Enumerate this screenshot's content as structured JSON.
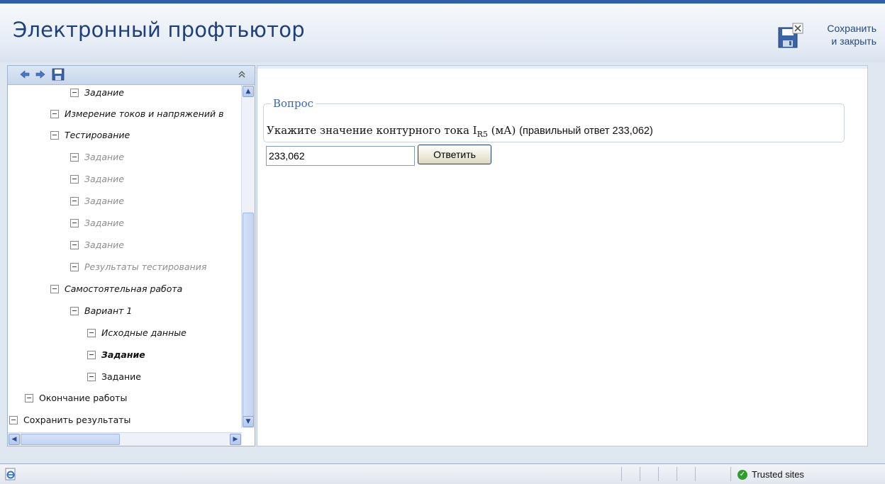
{
  "header": {
    "title": "Электронный профтьютор",
    "save_close_line1": "Сохранить",
    "save_close_line2": "и закрыть"
  },
  "nav": {
    "toolbar_icons": [
      "back-arrow-icon",
      "forward-arrow-icon",
      "save-icon",
      "collapse-icon"
    ],
    "items": [
      {
        "label": "Задание",
        "state": "normal"
      },
      {
        "label": "Измерение токов и напряжений в",
        "state": "normal"
      },
      {
        "label": "Тестирование",
        "state": "normal"
      },
      {
        "label": "Задание",
        "state": "dim"
      },
      {
        "label": "Задание",
        "state": "dim"
      },
      {
        "label": "Задание",
        "state": "dim"
      },
      {
        "label": "Задание",
        "state": "dim"
      },
      {
        "label": "Задание",
        "state": "dim"
      },
      {
        "label": "Результаты тестирования",
        "state": "dim"
      },
      {
        "label": "Самостоятельная работа",
        "state": "normal"
      },
      {
        "label": "Вариант 1",
        "state": "normal"
      },
      {
        "label": "Исходные данные",
        "state": "normal"
      },
      {
        "label": "Задание",
        "state": "bold"
      },
      {
        "label": "Задание",
        "state": "plain"
      },
      {
        "label": "Окончание работы",
        "state": "plain"
      },
      {
        "label": "Сохранить результаты",
        "state": "plain"
      }
    ]
  },
  "question": {
    "legend": "Вопрос",
    "text_before": "Укажите значение контурного тока I",
    "subscript": "R5",
    "text_unit": " (мА) ",
    "hint": "(правильный ответ 233,062)"
  },
  "answer": {
    "value": "233,062",
    "button_label": "Ответить"
  },
  "statusbar": {
    "zone_label": "Trusted sites"
  },
  "colors": {
    "title": "#1e3f78",
    "legend": "#3a66b8",
    "accent_border": "#2f5fa8",
    "trusted_icon": "#2f9e2f"
  }
}
